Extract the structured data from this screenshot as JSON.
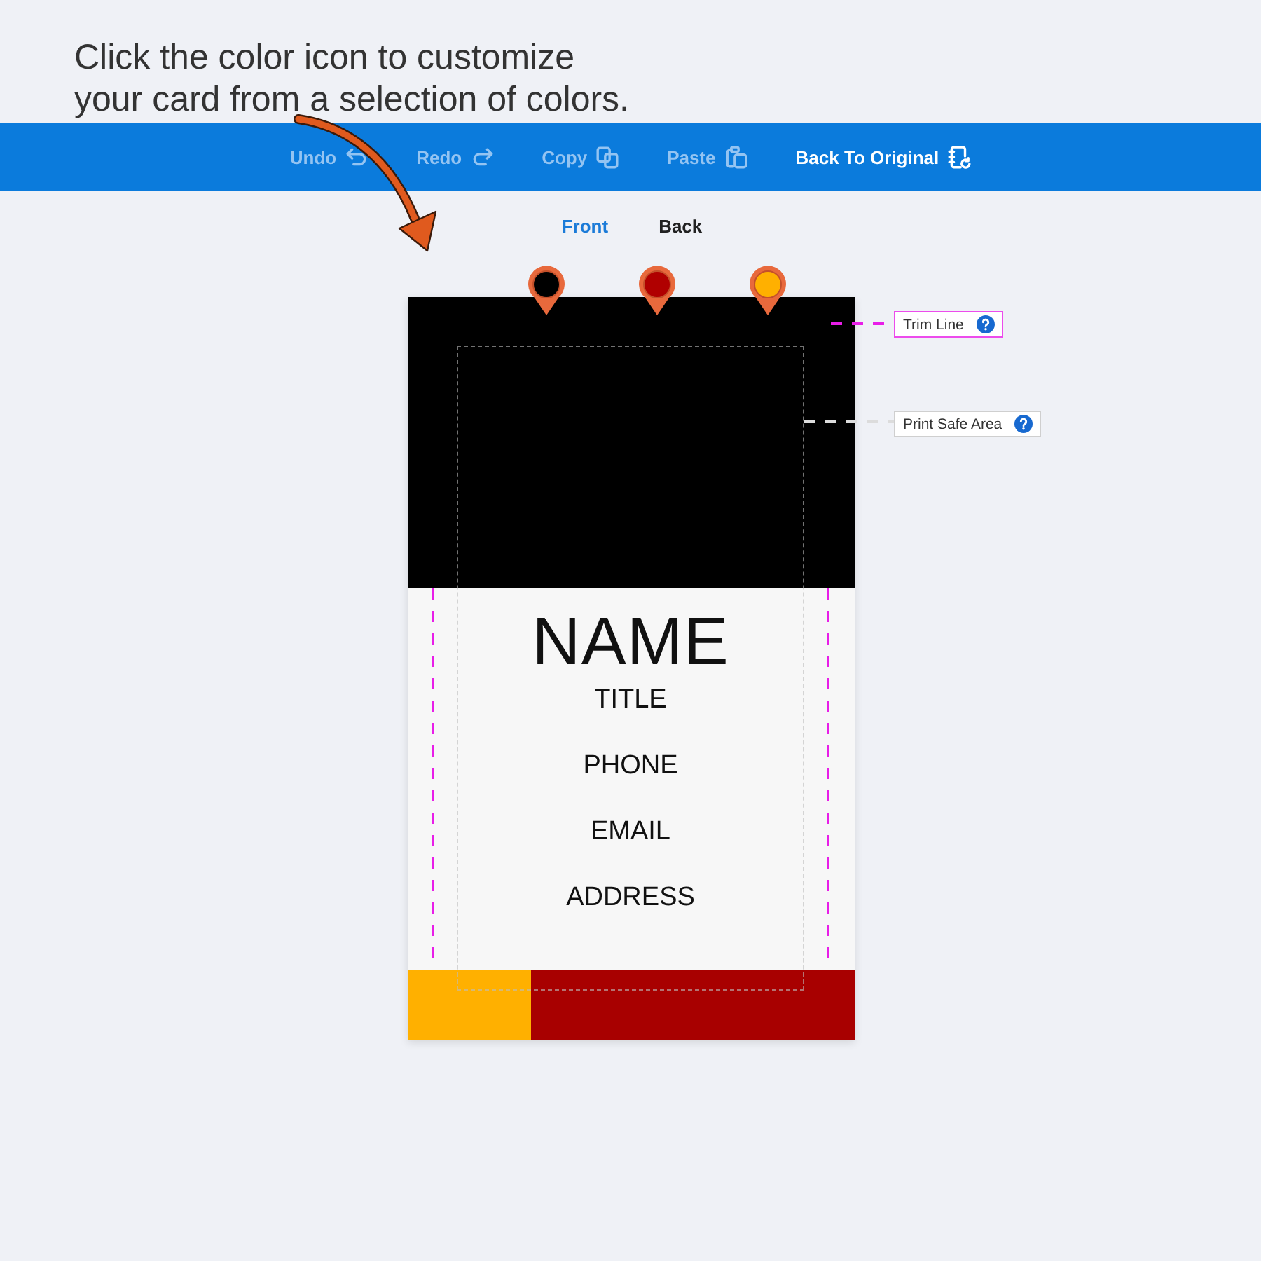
{
  "caption": {
    "lines": [
      "Click the color icon to customize",
      "your card from a selection of colors."
    ]
  },
  "toolbar": {
    "items": [
      {
        "label": "Undo",
        "kind": "undo",
        "disabled": true
      },
      {
        "label": "Redo",
        "kind": "redo",
        "disabled": true
      },
      {
        "label": "Copy",
        "kind": "copy",
        "disabled": true
      },
      {
        "label": "Paste",
        "kind": "paste",
        "disabled": true
      },
      {
        "label": "Back To Original",
        "kind": "restore",
        "disabled": false
      }
    ]
  },
  "tabs": [
    {
      "label": "Front",
      "selected": true
    },
    {
      "label": "Back",
      "selected": false
    }
  ],
  "color_markers": [
    {
      "color": "#000000"
    },
    {
      "color": "#b00000"
    },
    {
      "color": "#ffb000"
    }
  ],
  "card": {
    "lines": [
      {
        "kind": "name",
        "text": "NAME"
      },
      {
        "kind": "detail",
        "text": "TITLE"
      },
      {
        "kind": "detail",
        "text": "PHONE"
      },
      {
        "kind": "detail",
        "text": "EMAIL"
      },
      {
        "kind": "detail",
        "text": "ADDRESS"
      }
    ]
  },
  "guides": [
    {
      "kind": "trim",
      "label": "Trim Line"
    },
    {
      "kind": "safe",
      "label": "Print Safe Area"
    }
  ]
}
